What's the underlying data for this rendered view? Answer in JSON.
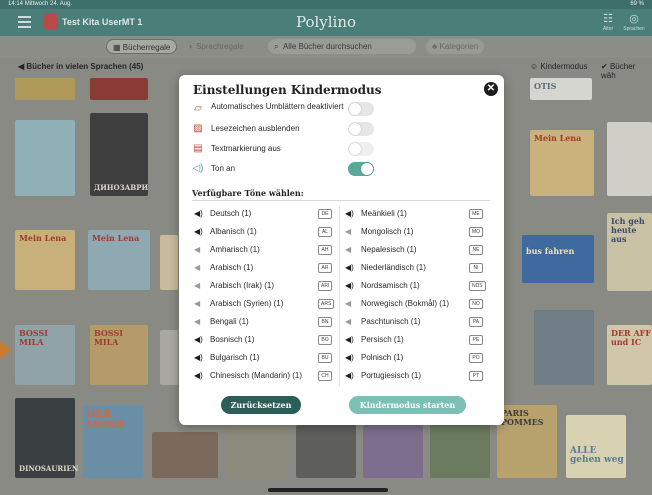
{
  "status": {
    "time": "14:14",
    "date": "Mittwoch 24. Aug.",
    "battery": "69 %"
  },
  "header": {
    "kita_name": "Test Kita UserMT 1",
    "app_title": "Polylino",
    "alter_label": "Alter",
    "sprachen_label": "Sprachen"
  },
  "filters": {
    "shelf": "Bücherregale",
    "language_shelf": "Sprachregale",
    "search_placeholder": "Alle Bücher durchsuchen",
    "categories": "Kategorien"
  },
  "section": {
    "title": "Bücher in vielen Sprachen (45)",
    "kindermodus": "Kindermodus",
    "buecher": "Bücher wäh"
  },
  "covers": {
    "dinosaurier": "ДИНОЗАВРИ",
    "mein_lena": "Mein Lena",
    "bossi": "BOSSI MILA",
    "bus": "bus fahren",
    "der_tag": "DER AFF und IC",
    "dinosaurier2": "DINOSAURIEN",
    "ich": "Ich geh heute aus",
    "otis": "OTIS",
    "alle": "ALLE gehen weg",
    "paris": "PARIS POMMES",
    "der_mond": "DER MOND"
  },
  "modal": {
    "title": "Einstellungen Kindermodus",
    "options": [
      {
        "label": "Automatisches Umblättern deaktiviert",
        "icon": "page-turn-icon",
        "on": false
      },
      {
        "label": "Lesezeichen ausblenden",
        "icon": "bookmark-off-icon",
        "on": false
      },
      {
        "label": "Textmarkierung aus",
        "icon": "highlight-off-icon",
        "on": false
      },
      {
        "label": "Ton an",
        "icon": "speaker-icon",
        "on": true
      }
    ],
    "voices_heading": "Verfügbare Töne wählen:",
    "languages_left": [
      {
        "name": "Deutsch (1)",
        "code": "DE",
        "active": true
      },
      {
        "name": "Albanisch (1)",
        "code": "AL",
        "active": true
      },
      {
        "name": "Amharisch (1)",
        "code": "AH",
        "active": false
      },
      {
        "name": "Arabisch (1)",
        "code": "AR",
        "active": false
      },
      {
        "name": "Arabisch (Irak) (1)",
        "code": "ARI",
        "active": false
      },
      {
        "name": "Arabisch (Syrien) (1)",
        "code": "ARS",
        "active": false
      },
      {
        "name": "Bengali (1)",
        "code": "BN",
        "active": false
      },
      {
        "name": "Bosnisch (1)",
        "code": "BO",
        "active": true
      },
      {
        "name": "Bulgarisch (1)",
        "code": "BU",
        "active": true
      },
      {
        "name": "Chinesisch (Mandarin) (1)",
        "code": "CH",
        "active": true
      }
    ],
    "languages_right": [
      {
        "name": "Meänkieli (1)",
        "code": "ME",
        "active": true
      },
      {
        "name": "Mongolisch (1)",
        "code": "MO",
        "active": false
      },
      {
        "name": "Nepalesisch (1)",
        "code": "NE",
        "active": false
      },
      {
        "name": "Niederländisch (1)",
        "code": "NI",
        "active": true
      },
      {
        "name": "Nordsamisch (1)",
        "code": "NDS",
        "active": true
      },
      {
        "name": "Norwegisch (Bokmål) (1)",
        "code": "NO",
        "active": false
      },
      {
        "name": "Paschtunisch (1)",
        "code": "PA",
        "active": false
      },
      {
        "name": "Persisch (1)",
        "code": "PE",
        "active": true
      },
      {
        "name": "Polnisch (1)",
        "code": "PO",
        "active": true
      },
      {
        "name": "Portugiesisch (1)",
        "code": "PT",
        "active": true
      }
    ],
    "back_label": "Zurücksetzen",
    "start_label": "Kindermodus starten"
  },
  "colors": {
    "accent": "#2d5d57",
    "toggle_on": "#5ba79a",
    "start_button": "#7cbfb4"
  }
}
